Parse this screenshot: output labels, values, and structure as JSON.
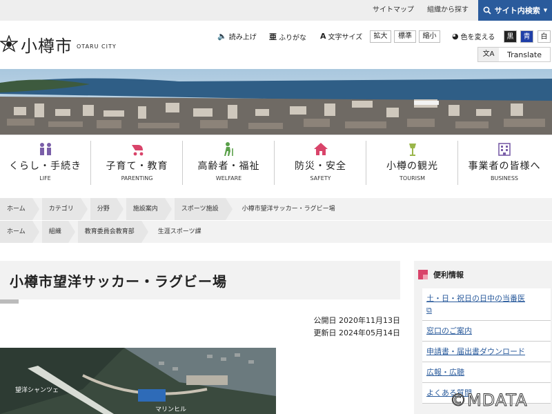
{
  "utility": {
    "sitemap": "サイトマップ",
    "find_by_org": "組織から探す",
    "site_search": "サイト内検索"
  },
  "header": {
    "city_name": "小樽市",
    "city_en": "OTARU CITY",
    "read_aloud": "読み上げ",
    "furigana": "ふりがな",
    "text_size": "文字サイズ",
    "size_large": "拡大",
    "size_normal": "標準",
    "size_small": "縮小",
    "color_change": "色を変える",
    "color_black": "黒",
    "color_blue": "青",
    "color_white": "白",
    "translate": "Translate",
    "translate_icon": "文A"
  },
  "categories": [
    {
      "label": "くらし・手続き",
      "en": "LIFE",
      "icon": "family-icon"
    },
    {
      "label": "子育て・教育",
      "en": "PARENTING",
      "icon": "stroller-icon"
    },
    {
      "label": "高齢者・福祉",
      "en": "WELFARE",
      "icon": "walking-cane-icon"
    },
    {
      "label": "防災・安全",
      "en": "SAFETY",
      "icon": "house-icon"
    },
    {
      "label": "小樽の観光",
      "en": "TOURISM",
      "icon": "gas-lamp-icon"
    },
    {
      "label": "事業者の皆様へ",
      "en": "BUSINESS",
      "icon": "building-icon"
    }
  ],
  "breadcrumbs1": [
    "ホーム",
    "カテゴリ",
    "分野",
    "施設案内",
    "スポーツ施設",
    "小樽市望洋サッカー・ラグビー場"
  ],
  "breadcrumbs2": [
    "ホーム",
    "組織",
    "教育委員会教育部",
    "生涯スポーツ課"
  ],
  "page": {
    "title": "小樽市望洋サッカー・ラグビー場",
    "published_label": "公開日",
    "published_date": "2020年11月13日",
    "updated_label": "更新日",
    "updated_date": "2024年05月14日",
    "photo_labels": [
      "望洋シャンツェ",
      "マリンヒル"
    ]
  },
  "sidebar": {
    "title": "便利情報",
    "items": [
      "土・日・祝日の日中の当番医",
      "窓口のご案内",
      "申請書・届出書ダウンロード",
      "広報・広聴",
      "よくある質問"
    ]
  },
  "watermark": "©MDATA",
  "colors": {
    "accent_blue": "#2a5b9c",
    "accent_pink": "#d9446a",
    "category_icon": "#7a5ea8"
  }
}
